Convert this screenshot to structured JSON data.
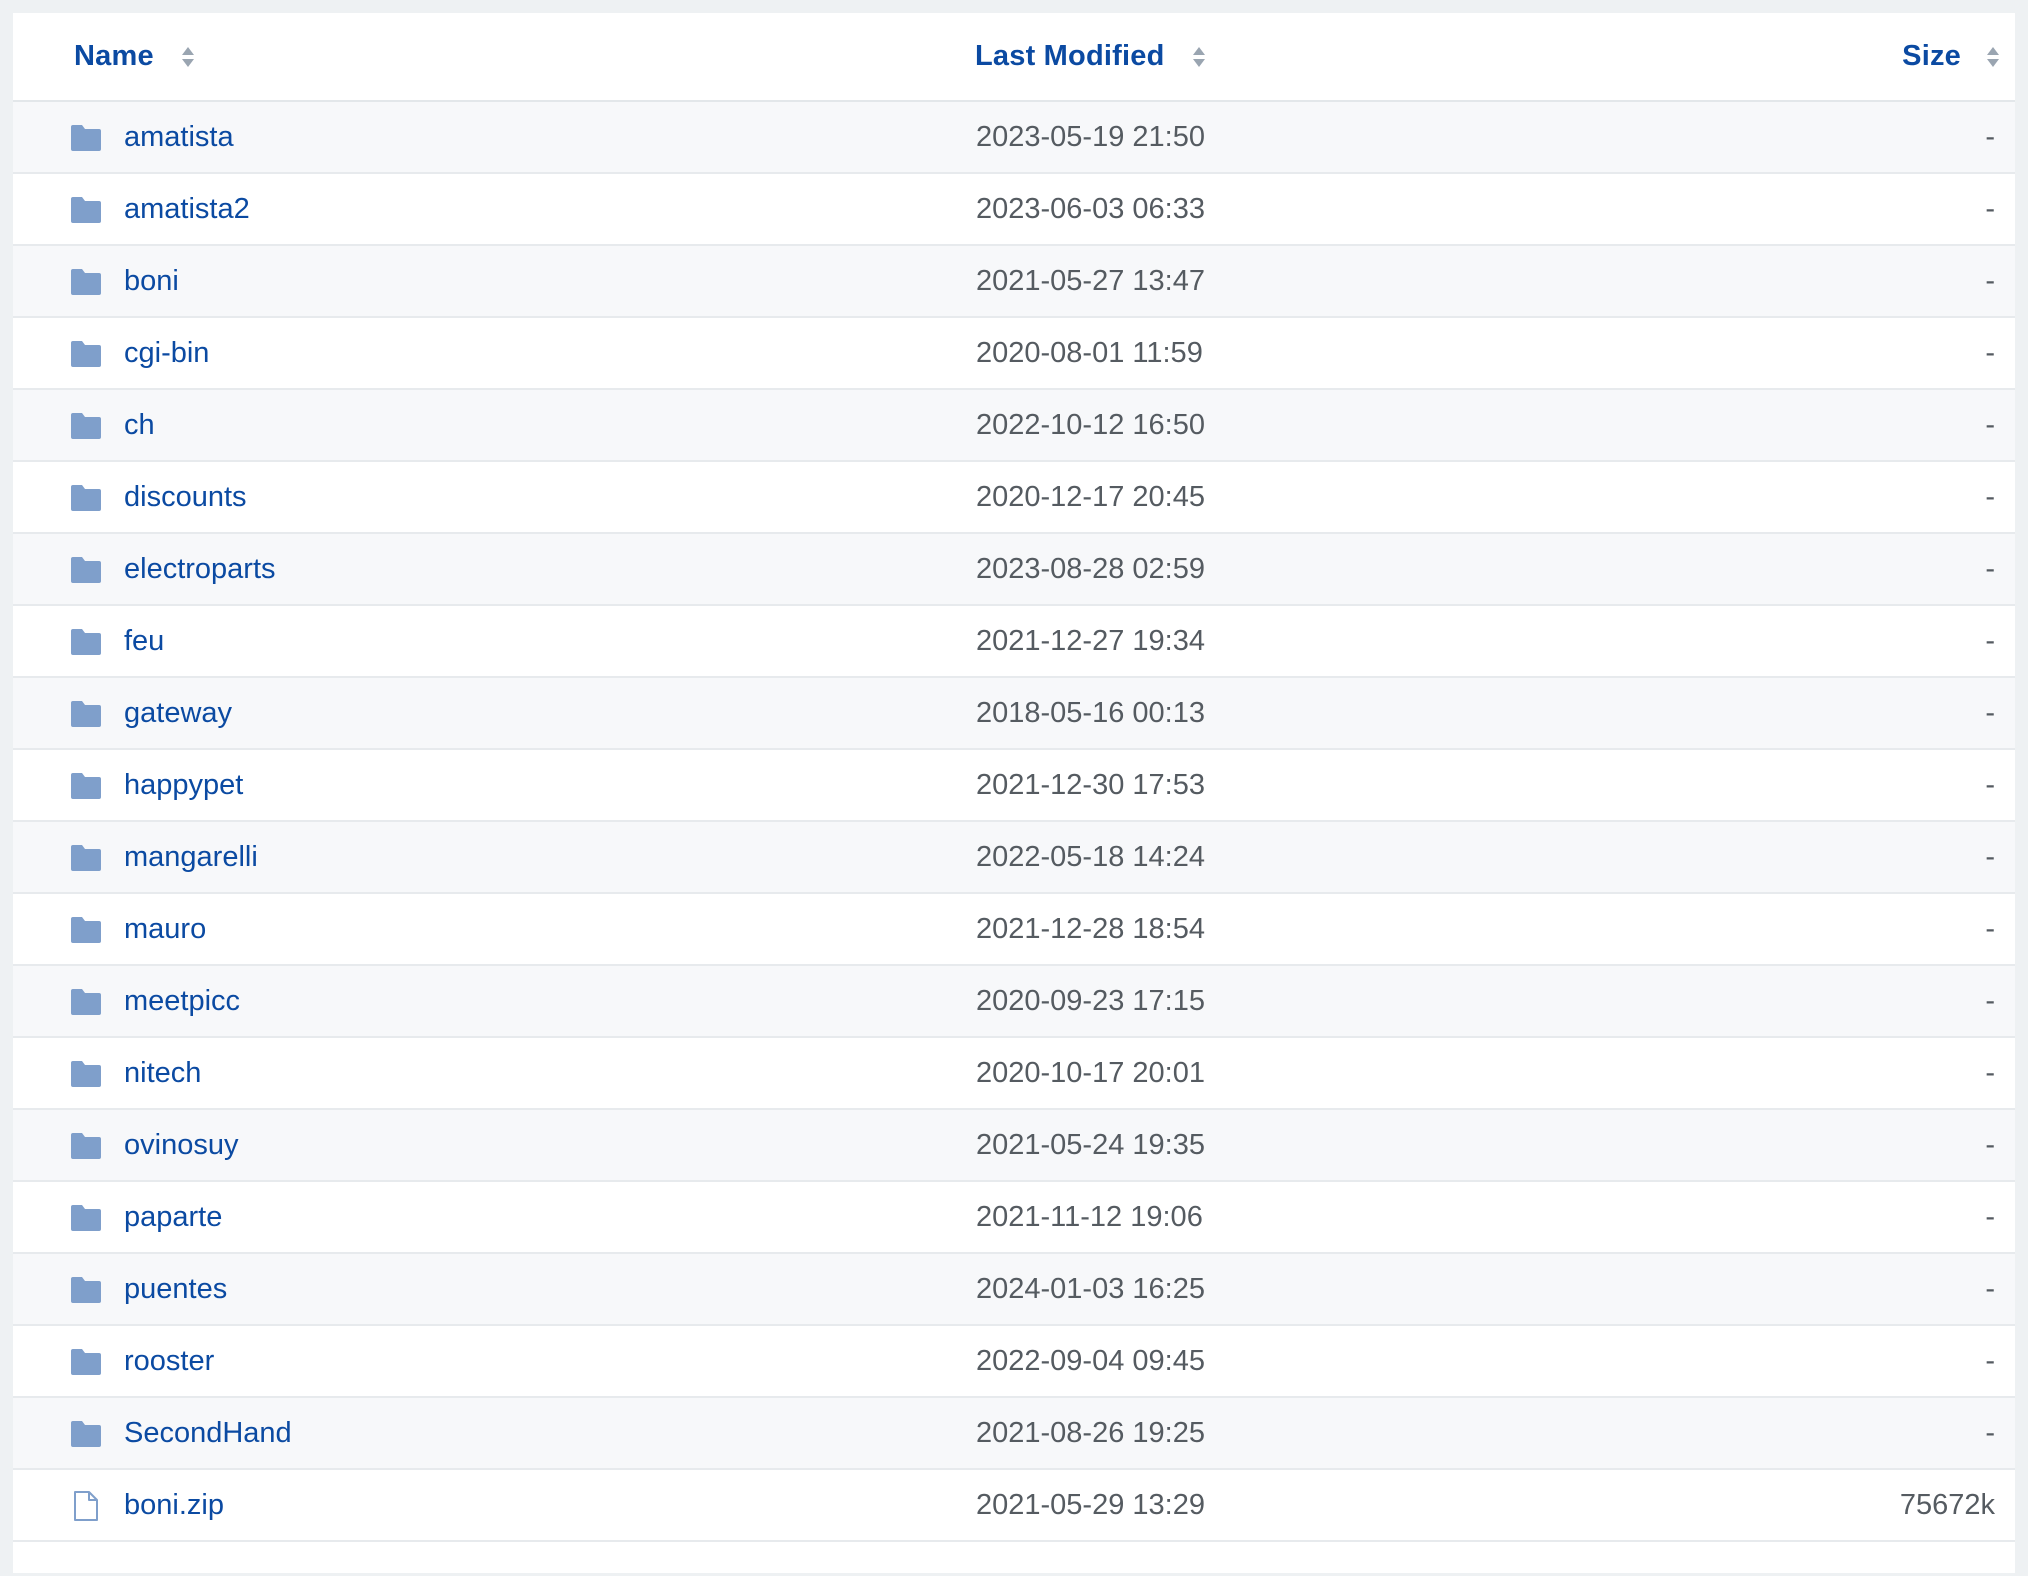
{
  "table": {
    "columns": {
      "name": "Name",
      "last_modified": "Last Modified",
      "size": "Size"
    },
    "rows": [
      {
        "name": "amatista",
        "modified": "2023-05-19 21:50",
        "size": "-",
        "type": "folder"
      },
      {
        "name": "amatista2",
        "modified": "2023-06-03 06:33",
        "size": "-",
        "type": "folder"
      },
      {
        "name": "boni",
        "modified": "2021-05-27 13:47",
        "size": "-",
        "type": "folder"
      },
      {
        "name": "cgi-bin",
        "modified": "2020-08-01 11:59",
        "size": "-",
        "type": "folder"
      },
      {
        "name": "ch",
        "modified": "2022-10-12 16:50",
        "size": "-",
        "type": "folder"
      },
      {
        "name": "discounts",
        "modified": "2020-12-17 20:45",
        "size": "-",
        "type": "folder"
      },
      {
        "name": "electroparts",
        "modified": "2023-08-28 02:59",
        "size": "-",
        "type": "folder"
      },
      {
        "name": "feu",
        "modified": "2021-12-27 19:34",
        "size": "-",
        "type": "folder"
      },
      {
        "name": "gateway",
        "modified": "2018-05-16 00:13",
        "size": "-",
        "type": "folder"
      },
      {
        "name": "happypet",
        "modified": "2021-12-30 17:53",
        "size": "-",
        "type": "folder"
      },
      {
        "name": "mangarelli",
        "modified": "2022-05-18 14:24",
        "size": "-",
        "type": "folder"
      },
      {
        "name": "mauro",
        "modified": "2021-12-28 18:54",
        "size": "-",
        "type": "folder"
      },
      {
        "name": "meetpicc",
        "modified": "2020-09-23 17:15",
        "size": "-",
        "type": "folder"
      },
      {
        "name": "nitech",
        "modified": "2020-10-17 20:01",
        "size": "-",
        "type": "folder"
      },
      {
        "name": "ovinosuy",
        "modified": "2021-05-24 19:35",
        "size": "-",
        "type": "folder"
      },
      {
        "name": "paparte",
        "modified": "2021-11-12 19:06",
        "size": "-",
        "type": "folder"
      },
      {
        "name": "puentes",
        "modified": "2024-01-03 16:25",
        "size": "-",
        "type": "folder"
      },
      {
        "name": "rooster",
        "modified": "2022-09-04 09:45",
        "size": "-",
        "type": "folder"
      },
      {
        "name": "SecondHand",
        "modified": "2021-08-26 19:25",
        "size": "-",
        "type": "folder"
      },
      {
        "name": "boni.zip",
        "modified": "2021-05-29 13:29",
        "size": "75672k",
        "type": "file"
      }
    ]
  },
  "icons": {
    "sort": "sort-icon",
    "folder": "folder-icon",
    "file": "file-icon"
  },
  "colors": {
    "link": "#0b4aa2",
    "folder_icon": "#7f9fcb",
    "text_muted": "#555b61",
    "row_stripe": "#f7f8fa",
    "background": "#eef1f3"
  }
}
